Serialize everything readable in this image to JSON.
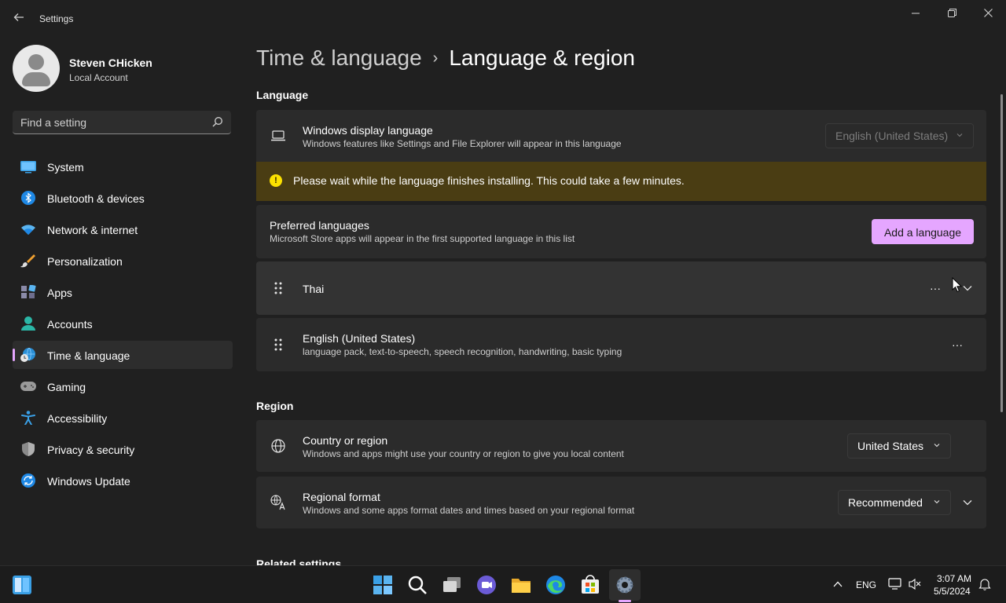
{
  "window": {
    "title": "Settings",
    "back_icon": "back-arrow-icon",
    "controls": [
      "minimize-icon",
      "restore-icon",
      "close-icon"
    ]
  },
  "profile": {
    "name": "Steven CHicken",
    "account": "Local Account"
  },
  "search": {
    "placeholder": "Find a setting"
  },
  "nav": {
    "items": [
      {
        "label": "System",
        "icon": "system-icon"
      },
      {
        "label": "Bluetooth & devices",
        "icon": "bluetooth-icon"
      },
      {
        "label": "Network & internet",
        "icon": "wifi-icon"
      },
      {
        "label": "Personalization",
        "icon": "brush-icon"
      },
      {
        "label": "Apps",
        "icon": "apps-icon"
      },
      {
        "label": "Accounts",
        "icon": "accounts-icon"
      },
      {
        "label": "Time & language",
        "icon": "time-language-icon",
        "selected": true
      },
      {
        "label": "Gaming",
        "icon": "gamepad-icon"
      },
      {
        "label": "Accessibility",
        "icon": "accessibility-icon"
      },
      {
        "label": "Privacy & security",
        "icon": "shield-icon"
      },
      {
        "label": "Windows Update",
        "icon": "update-icon"
      }
    ]
  },
  "breadcrumb": {
    "parent": "Time & language",
    "separator": "›",
    "current": "Language & region"
  },
  "language": {
    "heading": "Language",
    "display": {
      "title": "Windows display language",
      "subtitle": "Windows features like Settings and File Explorer will appear in this language",
      "value": "English (United States)"
    },
    "warning": "Please wait while the language finishes installing. This could take a few minutes.",
    "preferred": {
      "title": "Preferred languages",
      "subtitle": "Microsoft Store apps will appear in the first supported language in this list",
      "add_button": "Add a language"
    },
    "list": [
      {
        "name": "Thai",
        "detail": ""
      },
      {
        "name": "English (United States)",
        "detail": "language pack, text-to-speech, speech recognition, handwriting, basic typing"
      }
    ],
    "more_label": "···"
  },
  "region": {
    "heading": "Region",
    "country": {
      "title": "Country or region",
      "subtitle": "Windows and apps might use your country or region to give you local content",
      "value": "United States"
    },
    "format": {
      "title": "Regional format",
      "subtitle": "Windows and some apps format dates and times based on your regional format",
      "value": "Recommended"
    }
  },
  "related": {
    "heading": "Related settings"
  },
  "taskbar": {
    "apps": [
      "windows-start-icon",
      "search-icon",
      "task-view-icon",
      "chat-icon",
      "file-explorer-icon",
      "edge-icon",
      "store-icon",
      "settings-icon"
    ],
    "tray": {
      "lang": "ENG",
      "time": "3:07 AM",
      "date": "5/5/2024"
    }
  },
  "colors": {
    "accent": "#e5a6ff",
    "warning_bg": "#4a3d13",
    "card_bg": "#2b2b2b",
    "window_bg": "#202020"
  }
}
